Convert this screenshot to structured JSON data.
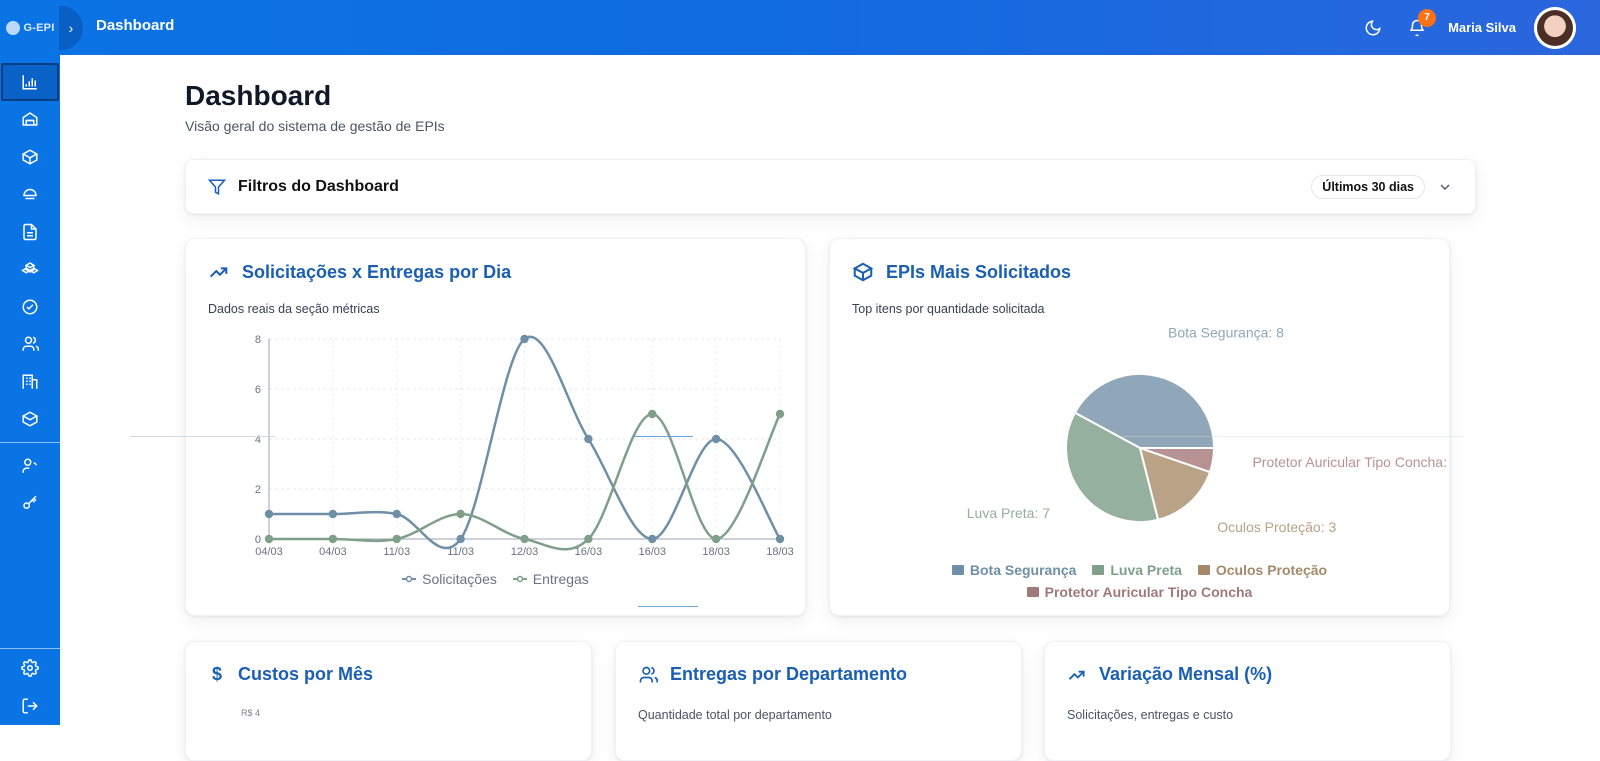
{
  "app": {
    "logo_text": "G-EPI",
    "top_title": "Dashboard",
    "user_name": "Maria Silva",
    "notifications_count": "7"
  },
  "page": {
    "title": "Dashboard",
    "subtitle": "Visão geral do sistema de gestão de EPIs"
  },
  "filters": {
    "label": "Filtros do Dashboard",
    "range": "Últimos 30 dias"
  },
  "cards": {
    "line": {
      "title": "Solicitações x Entregas por Dia",
      "subtitle": "Dados reais da seção métricas"
    },
    "pie": {
      "title": "EPIs Mais Solicitados",
      "subtitle": "Top itens por quantidade solicitada"
    },
    "costs": {
      "title": "Custos por Mês",
      "subtitle": "R$ 4"
    },
    "departments": {
      "title": "Entregas por Departamento",
      "subtitle": "Quantidade total por departamento"
    },
    "variation": {
      "title": "Variação Mensal (%)",
      "subtitle": "Solicitações, entregas e custo"
    }
  },
  "chart_data": [
    {
      "type": "line",
      "categories": [
        "04/03",
        "04/03",
        "11/03",
        "11/03",
        "12/03",
        "16/03",
        "16/03",
        "18/03",
        "18/03"
      ],
      "ylim": [
        0,
        8
      ],
      "yticks": [
        0,
        2,
        4,
        6,
        8
      ],
      "grid": true,
      "legend": "bottom",
      "series": [
        {
          "name": "Solicitações",
          "values": [
            1,
            1,
            1,
            0,
            8,
            4,
            0,
            4,
            0
          ],
          "color": "#6f8fa7"
        },
        {
          "name": "Entregas",
          "values": [
            0,
            0,
            0,
            1,
            0,
            0,
            5,
            0,
            5
          ],
          "color": "#7f9f8a"
        }
      ]
    },
    {
      "type": "pie",
      "legend": "bottom",
      "slices": [
        {
          "label": "Bota Segurança",
          "value": 8,
          "color": "#8fa7b8"
        },
        {
          "label": "Luva Preta",
          "value": 7,
          "color": "#95b09e"
        },
        {
          "label": "Oculos Proteção",
          "value": 3,
          "color": "#b9a286"
        },
        {
          "label": "Protetor Auricular Tipo Concha",
          "value": 1,
          "color": "#b79393"
        }
      ]
    }
  ],
  "icons": {
    "top": [
      "moon-icon",
      "bell-icon"
    ],
    "sidebar": [
      "bar-chart-icon",
      "warehouse-icon",
      "package-icon",
      "helmet-icon",
      "document-icon",
      "boxes-icon",
      "check-circle-icon",
      "users-icon",
      "building-icon",
      "cube-icon",
      "user-settings-icon",
      "key-icon",
      "settings-icon",
      "logout-icon"
    ]
  }
}
